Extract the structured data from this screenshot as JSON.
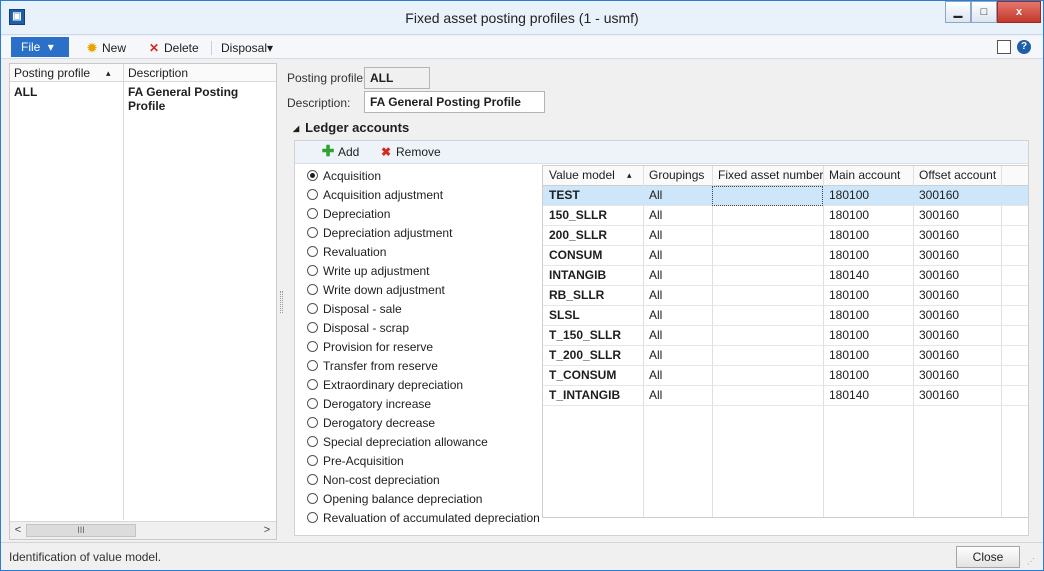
{
  "window": {
    "title": "Fixed asset posting profiles (1 - usmf)",
    "min_glyph": "▁",
    "max_glyph": "□",
    "close_glyph": "x",
    "app_icon_glyph": "▣"
  },
  "toolbar": {
    "file_label": "File",
    "file_arrow": "▾",
    "new_label": "New",
    "delete_label": "Delete",
    "disposal_label": "Disposal",
    "disposal_arrow": "▾",
    "help_glyph": "?"
  },
  "list": {
    "headers": [
      "Posting profile",
      "Description"
    ],
    "sort_glyph": "▴",
    "rows": [
      {
        "profile": "ALL",
        "description": "FA General Posting Profile"
      }
    ],
    "scroll_left": "<",
    "scroll_right": ">",
    "scroll_thumb": "III"
  },
  "form": {
    "posting_profile_label": "Posting profile:",
    "posting_profile_value": "ALL",
    "description_label": "Description:",
    "description_value": "FA General Posting Profile"
  },
  "ledger": {
    "section_title": "Ledger accounts",
    "collapse_glyph": "◢",
    "add_label": "Add",
    "add_glyph": "✚",
    "remove_label": "Remove",
    "remove_glyph": "✖",
    "transaction_types": [
      {
        "label": "Acquisition",
        "selected": true
      },
      {
        "label": "Acquisition adjustment",
        "selected": false
      },
      {
        "label": "Depreciation",
        "selected": false
      },
      {
        "label": "Depreciation adjustment",
        "selected": false
      },
      {
        "label": "Revaluation",
        "selected": false
      },
      {
        "label": "Write up adjustment",
        "selected": false
      },
      {
        "label": "Write down adjustment",
        "selected": false
      },
      {
        "label": "Disposal - sale",
        "selected": false
      },
      {
        "label": "Disposal - scrap",
        "selected": false
      },
      {
        "label": "Provision for reserve",
        "selected": false
      },
      {
        "label": "Transfer from reserve",
        "selected": false
      },
      {
        "label": "Extraordinary depreciation",
        "selected": false
      },
      {
        "label": "Derogatory increase",
        "selected": false
      },
      {
        "label": "Derogatory decrease",
        "selected": false
      },
      {
        "label": "Special depreciation allowance",
        "selected": false
      },
      {
        "label": "Pre-Acquisition",
        "selected": false
      },
      {
        "label": "Non-cost depreciation",
        "selected": false
      },
      {
        "label": "Opening balance depreciation",
        "selected": false
      },
      {
        "label": "Revaluation of accumulated depreciation",
        "selected": false
      }
    ],
    "grid_headers": [
      "Value model",
      "Groupings",
      "Fixed asset number",
      "Main account",
      "Offset account"
    ],
    "grid_sort_glyph": "▴",
    "grid_rows": [
      [
        "TEST",
        "All",
        "",
        "180100",
        "300160"
      ],
      [
        "150_SLLR",
        "All",
        "",
        "180100",
        "300160"
      ],
      [
        "200_SLLR",
        "All",
        "",
        "180100",
        "300160"
      ],
      [
        "CONSUM",
        "All",
        "",
        "180100",
        "300160"
      ],
      [
        "INTANGIB",
        "All",
        "",
        "180140",
        "300160"
      ],
      [
        "RB_SLLR",
        "All",
        "",
        "180100",
        "300160"
      ],
      [
        "SLSL",
        "All",
        "",
        "180100",
        "300160"
      ],
      [
        "T_150_SLLR",
        "All",
        "",
        "180100",
        "300160"
      ],
      [
        "T_200_SLLR",
        "All",
        "",
        "180100",
        "300160"
      ],
      [
        "T_CONSUM",
        "All",
        "",
        "180100",
        "300160"
      ],
      [
        "T_INTANGIB",
        "All",
        "",
        "180140",
        "300160"
      ]
    ]
  },
  "status": {
    "text": "Identification of value model.",
    "close_label": "Close"
  },
  "colors": {
    "accent": "#2b70c8",
    "selected_row": "#cde6fa",
    "add_green": "#2ea12e",
    "delete_red": "#d32b1f"
  }
}
